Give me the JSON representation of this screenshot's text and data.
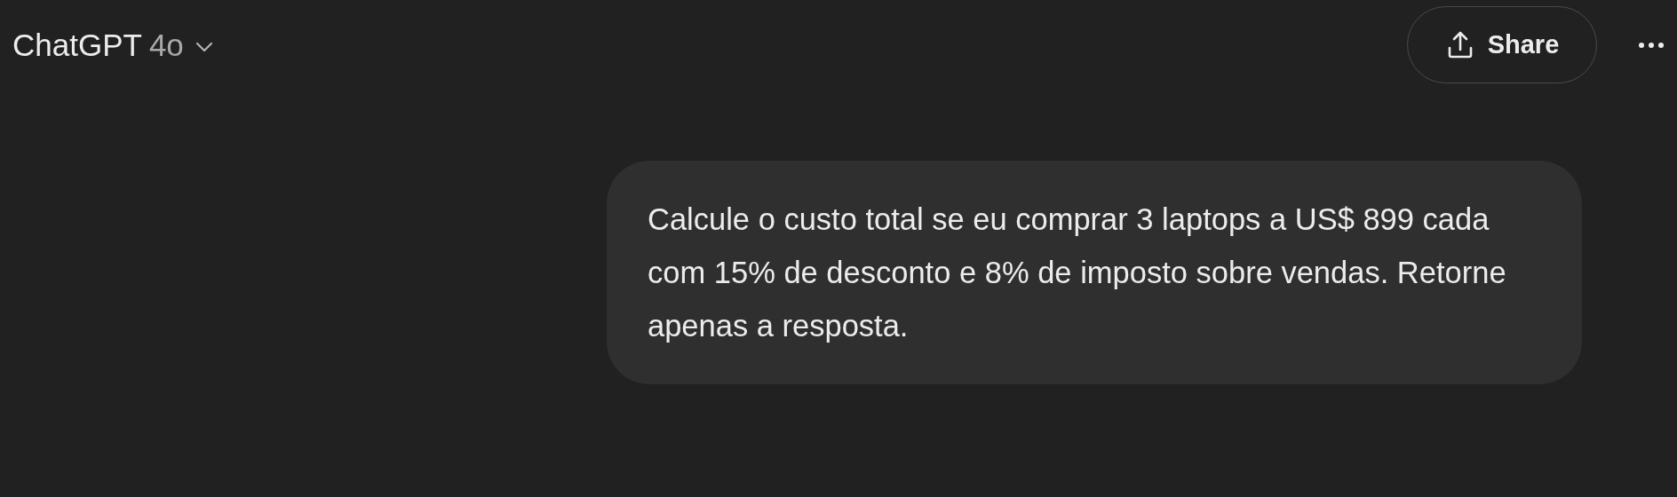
{
  "header": {
    "title": "ChatGPT",
    "model": "4o",
    "share_button": "Share"
  },
  "user_message": "Calcule o custo total se eu comprar 3 laptops a US$ 899 cada com 15% de desconto e 8% de imposto sobre vendas. Retorne apenas a resposta."
}
